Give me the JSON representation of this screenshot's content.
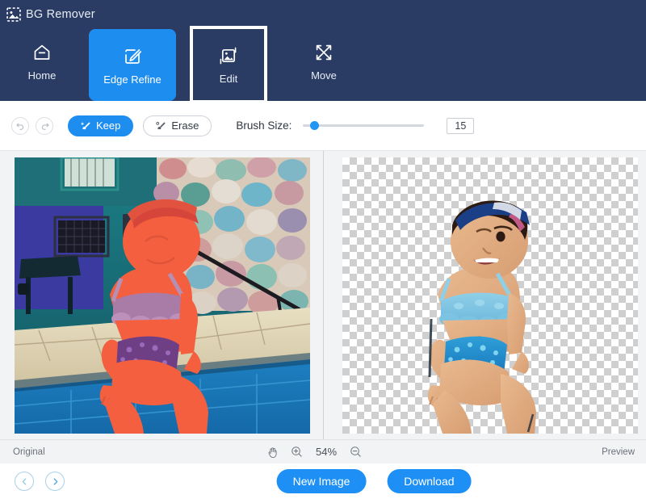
{
  "app": {
    "title": "BG Remover",
    "logo_icon": "image-dashed-icon"
  },
  "nav": {
    "items": [
      {
        "label": "Home",
        "icon": "home-icon",
        "state": "default"
      },
      {
        "label": "Edge Refine",
        "icon": "edge-refine-icon",
        "state": "active"
      },
      {
        "label": "Edit",
        "icon": "edit-image-icon",
        "state": "focused"
      },
      {
        "label": "Move",
        "icon": "move-arrows-icon",
        "state": "default"
      }
    ]
  },
  "toolbar": {
    "undo_icon": "undo-arrow-icon",
    "redo_icon": "redo-arrow-icon",
    "keep_label": "Keep",
    "keep_icon": "keep-brush-icon",
    "erase_label": "Erase",
    "erase_icon": "erase-brush-icon",
    "brush_size_label": "Brush Size:",
    "brush_size_value": "15",
    "brush_slider": {
      "min": 1,
      "max": 100,
      "value": 15,
      "percent": 6
    }
  },
  "canvas": {
    "left_pane": {
      "label": "Original",
      "description": "Toddler in blue swimsuit sitting on pool edge, subject masked with red keep overlay"
    },
    "right_pane": {
      "label": "Preview",
      "description": "Cut-out toddler on transparent checkerboard background"
    }
  },
  "statusbar": {
    "left_label": "Original",
    "right_label": "Preview",
    "pan_icon": "hand-pan-icon",
    "zoom_in_icon": "zoom-in-icon",
    "zoom_out_icon": "zoom-out-icon",
    "zoom_level": "54%"
  },
  "footer": {
    "prev_icon": "chevron-left-icon",
    "next_icon": "chevron-right-icon",
    "new_image_label": "New Image",
    "download_label": "Download"
  },
  "colors": {
    "header_bg": "#2a3c63",
    "accent_blue": "#1e8df0",
    "action_blue": "#1e90f5",
    "canvas_bg": "#f2f3f5",
    "toolbar_bg": "#ffffff",
    "mask_red": "#f4603f"
  }
}
